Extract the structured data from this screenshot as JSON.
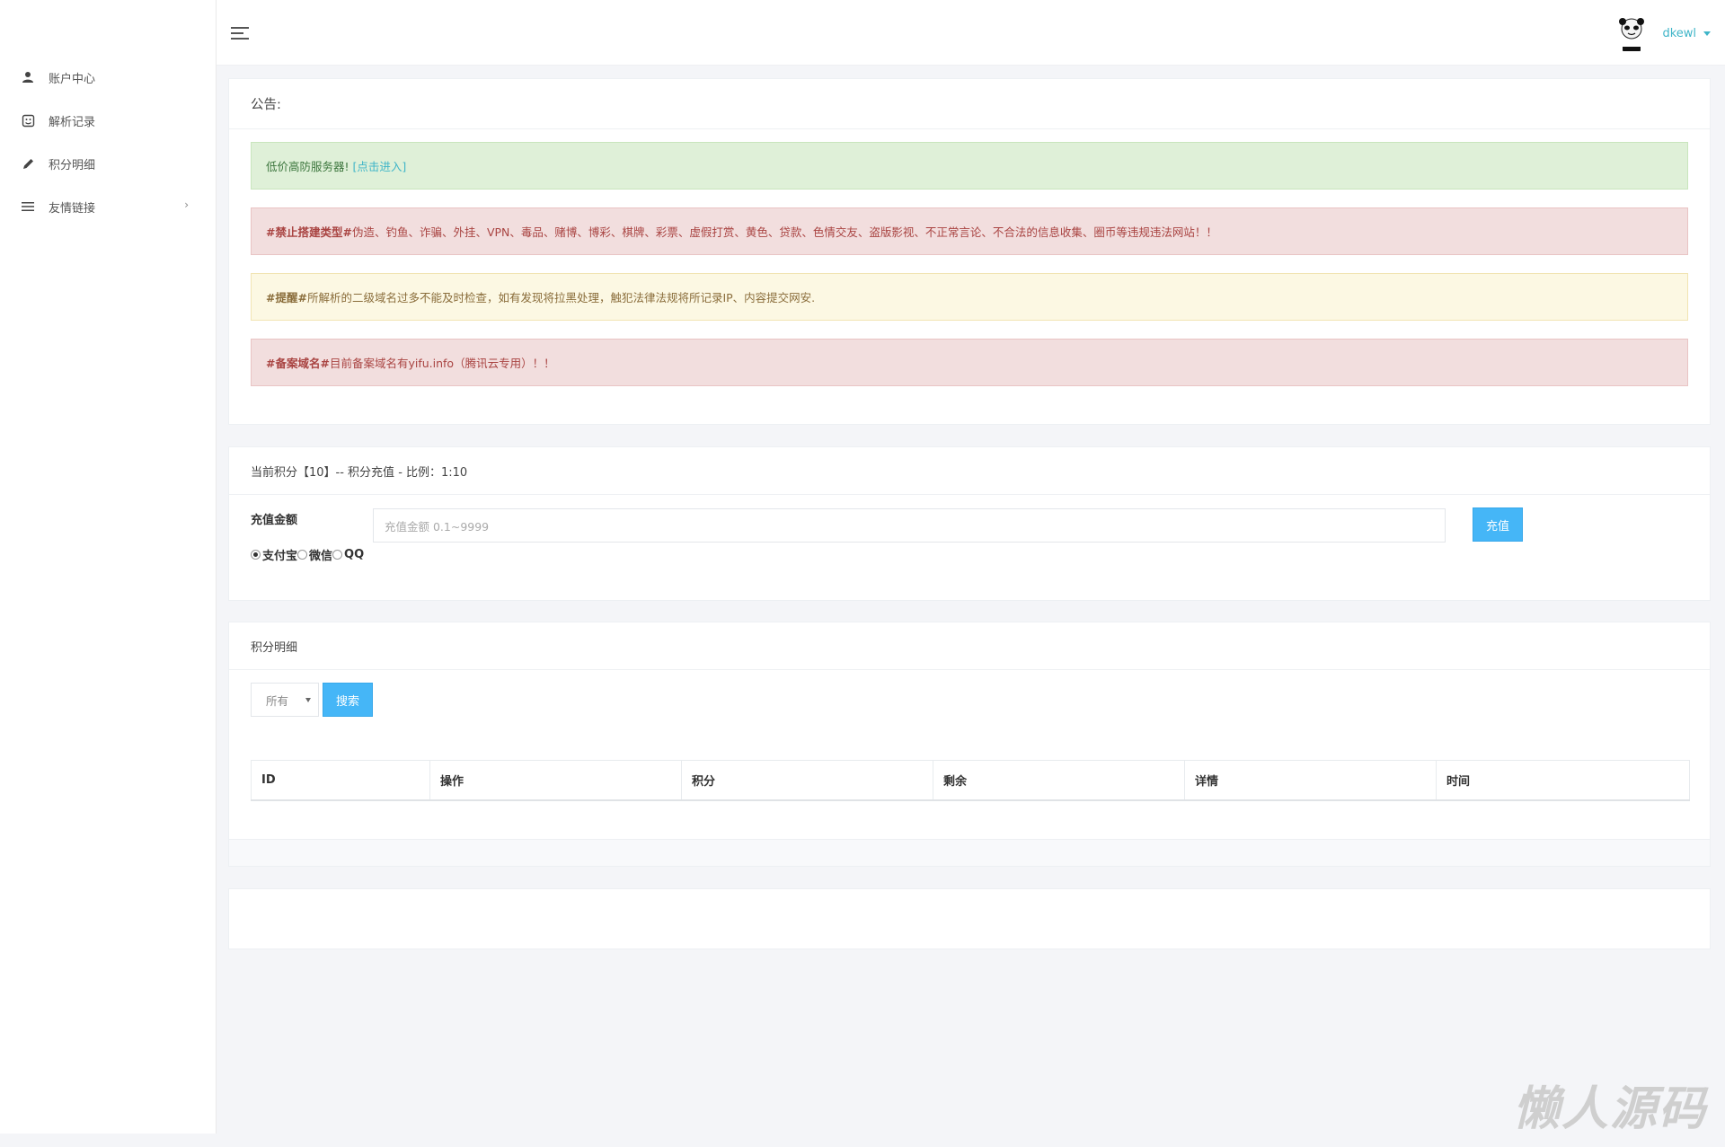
{
  "sidebar": {
    "items": [
      {
        "label": "账户中心",
        "icon": "user-icon"
      },
      {
        "label": "解析记录",
        "icon": "record-icon"
      },
      {
        "label": "积分明细",
        "icon": "pencil-icon"
      },
      {
        "label": "友情链接",
        "icon": "list-icon",
        "arrow": "›"
      }
    ]
  },
  "topbar": {
    "username": "dkewl",
    "avatar_caption": "上班过够"
  },
  "notice": {
    "title": "公告:",
    "alerts": [
      {
        "prefix": "",
        "text": "低价高防服务器!",
        "link": "[点击进入]"
      },
      {
        "prefix": "#禁止搭建类型#",
        "text": " 伪造、钓鱼、诈骗、外挂、VPN、毒品、赌博、博彩、棋牌、彩票、虚假打赏、黄色、贷款、色情交友、盗版影视、不正常言论、不合法的信息收集、圈币等违规违法网站！！"
      },
      {
        "prefix": "#提醒#",
        "text": " 所解析的二级域名过多不能及时检查，如有发现将拉黑处理，触犯法律法规将所记录IP、内容提交网安."
      },
      {
        "prefix": "#备案域名#",
        "text": " 目前备案域名有yifu.info（腾讯云专用）！！"
      }
    ]
  },
  "recharge": {
    "title": "当前积分【10】-- 积分充值 - 比例：1:10",
    "amount_label": "充值金额",
    "amount_placeholder": "充值金额 0.1~9999",
    "submit_label": "充值",
    "payments": [
      "支付宝",
      "微信",
      "QQ"
    ],
    "selected_payment": "支付宝"
  },
  "points": {
    "title": "积分明细",
    "filter_value": "所有",
    "search_label": "搜索",
    "columns": [
      "ID",
      "操作",
      "积分",
      "剩余",
      "详情",
      "时间"
    ]
  },
  "watermark": "懒人源码",
  "colors": {
    "accent": "#45b6f7",
    "link": "#3fb5c8"
  }
}
